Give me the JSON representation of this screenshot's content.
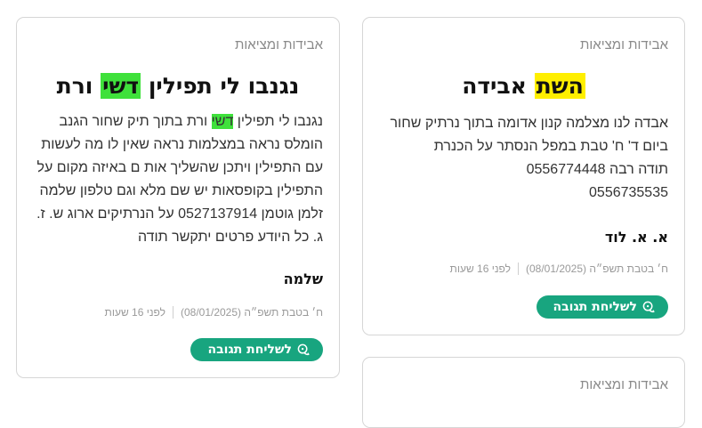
{
  "cards": [
    {
      "category": "אבידות ומציאות",
      "title_before": "נגנבו לי תפילין ",
      "title_highlight": "דשי",
      "title_after": " ורת",
      "body_before": "נגנבו לי תפילין ",
      "body_highlight": "דשי",
      "body_after": " ורת בתוך תיק שחור הגנב הומלס נראה במצלמות נראה שאין לו מה לעשות עם התפילין ויתכן שהשליך אות ם באיזה מקום על התפילין בקופסאות יש שם מלא וגם טלפון שלמה זלמן גוטמן 0527137914 על הנרתיקים ארוג ש. ז. ג. כל היודע פרטים יתקשר תודה",
      "signature": "שלמה",
      "date": "ח׳ בטבת תשפ״ה (08/01/2025)",
      "ago": "לפני 16 שעות",
      "reply_label": "לשליחת תגובה"
    },
    {
      "category": "אבידות ומציאות",
      "title_highlight": "השת",
      "title_after": " אבידה",
      "body_lines": [
        "אבדה לנו מצלמה קנון אדומה בתוך נרתיק שחור",
        "ביום ד' ח' טבת במפל הנסתר על הכנרת",
        "תודה רבה 0556774448",
        "0556735535"
      ],
      "signature": "א. א. לוד",
      "date": "ח׳ בטבת תשפ״ה (08/01/2025)",
      "ago": "לפני 16 שעות",
      "reply_label": "לשליחת תגובה"
    },
    {
      "category": "אבידות ומציאות"
    }
  ],
  "colors": {
    "accent": "#18a57f",
    "highlight_green": "#3fe13b",
    "highlight_yellow": "#ffef00"
  },
  "icons": {
    "reply": "chat-bubbles-icon"
  }
}
